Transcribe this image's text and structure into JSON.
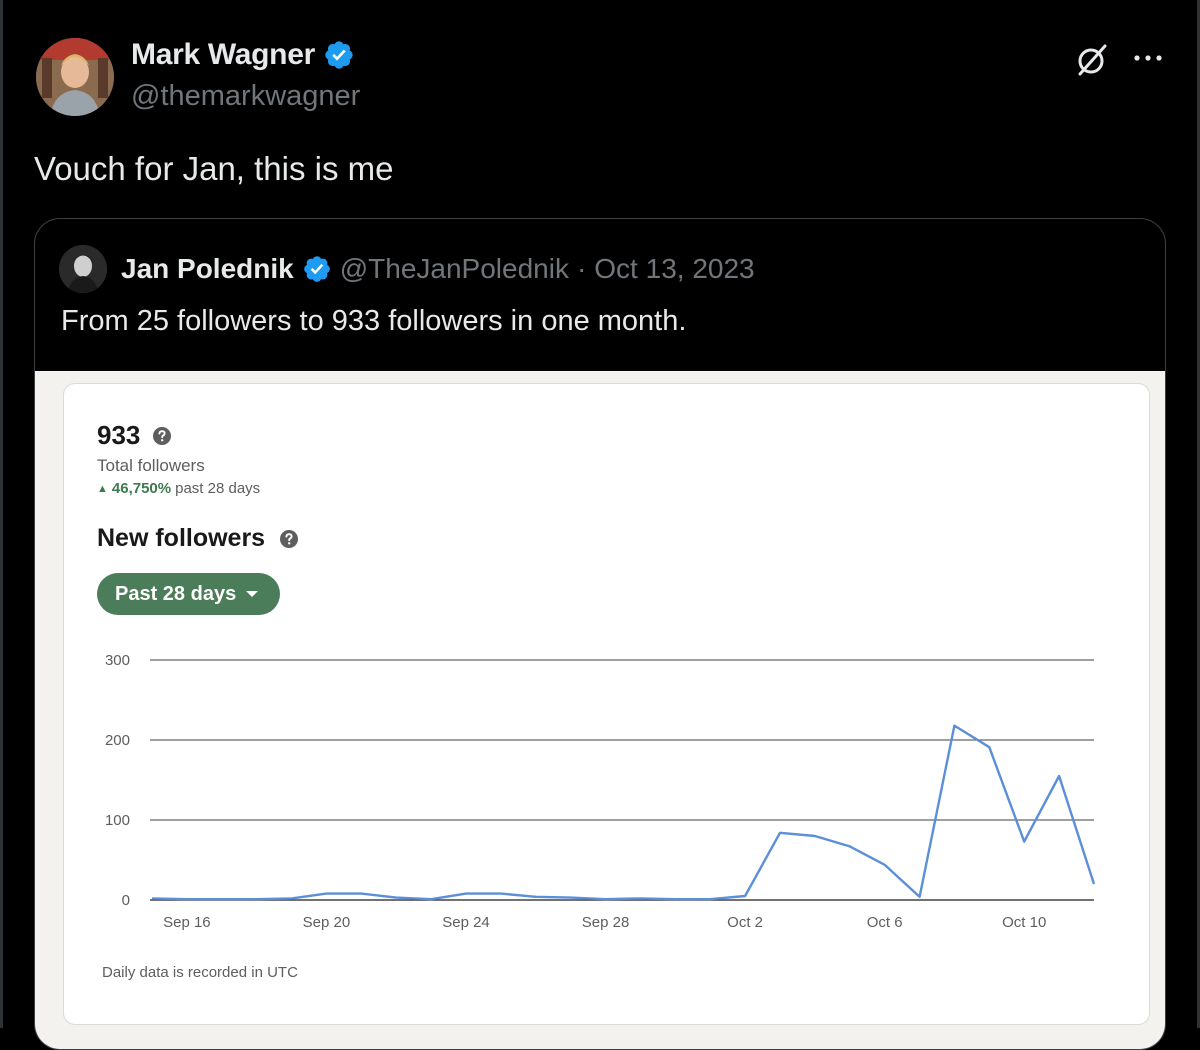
{
  "author": {
    "name": "Mark Wagner",
    "handle": "@themarkwagner",
    "verified": true
  },
  "icons": {
    "grok": "grok-slash-circle-icon",
    "more": "more-horizontal-icon",
    "verified": "verified-badge-icon",
    "help": "question-circle-icon"
  },
  "tweet": {
    "text": "Vouch for Jan, this is me"
  },
  "quote": {
    "name": "Jan Polednik",
    "handle": "@TheJanPolednik",
    "separator": "·",
    "date": "Oct 13, 2023",
    "text": "From 25 followers to 933 followers in one month."
  },
  "analytics": {
    "total_value": "933",
    "total_label": "Total followers",
    "growth_arrow": "▲",
    "growth_value": "46,750%",
    "growth_period": "past 28 days",
    "section_title": "New followers",
    "range_label": "Past 28 days",
    "footnote": "Daily data is recorded in UTC"
  },
  "colors": {
    "verified_blue": "#1d9bf0",
    "line": "#5b8fd8",
    "green": "#4b7d5a"
  },
  "chart_data": {
    "type": "line",
    "x": [
      "Sep 15",
      "Sep 16",
      "Sep 17",
      "Sep 18",
      "Sep 19",
      "Sep 20",
      "Sep 21",
      "Sep 22",
      "Sep 23",
      "Sep 24",
      "Sep 25",
      "Sep 26",
      "Sep 27",
      "Sep 28",
      "Sep 29",
      "Sep 30",
      "Oct 1",
      "Oct 2",
      "Oct 3",
      "Oct 4",
      "Oct 5",
      "Oct 6",
      "Oct 7",
      "Oct 8",
      "Oct 9",
      "Oct 10",
      "Oct 11",
      "Oct 12"
    ],
    "values": [
      2,
      1,
      1,
      1,
      2,
      8,
      8,
      3,
      1,
      8,
      8,
      4,
      3,
      1,
      2,
      1,
      1,
      5,
      84,
      80,
      67,
      44,
      4,
      218,
      191,
      73,
      155,
      20
    ],
    "xticks": [
      "Sep 16",
      "Sep 20",
      "Sep 24",
      "Sep 28",
      "Oct 2",
      "Oct 6",
      "Oct 10"
    ],
    "yticks": [
      "0",
      "100",
      "200",
      "300"
    ],
    "ylim": [
      0,
      300
    ],
    "grid": true,
    "xlabel": "",
    "ylabel": "",
    "title": ""
  }
}
